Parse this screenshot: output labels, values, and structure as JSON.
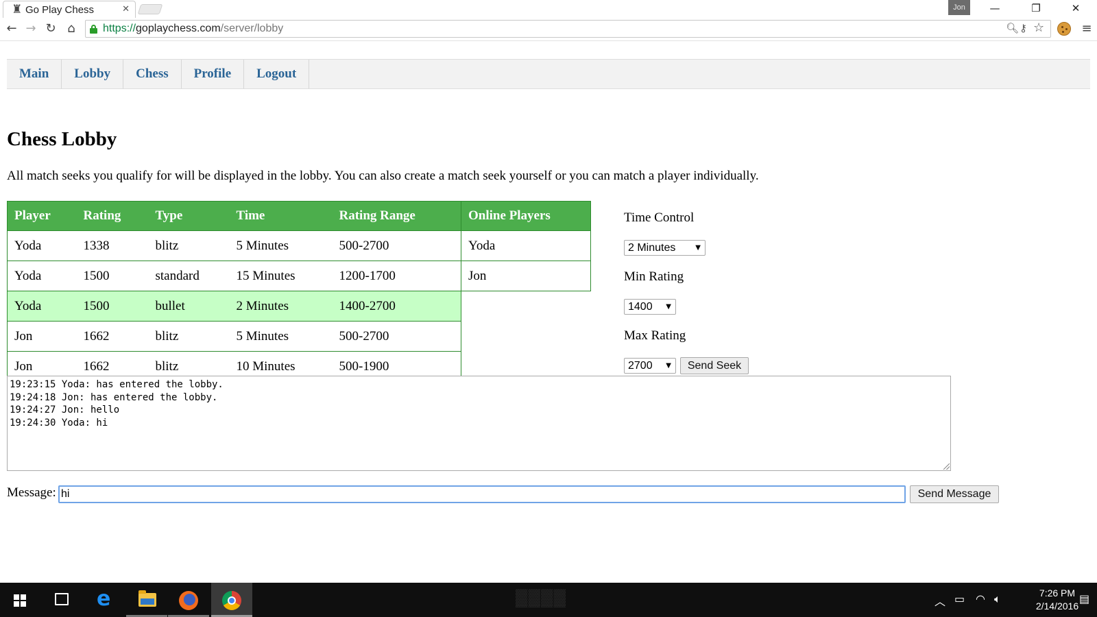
{
  "browser": {
    "tab_title": "Go Play Chess",
    "tab_icon": "rook-icon",
    "profile_name": "Jon",
    "url_scheme": "https://",
    "url_host": "goplaychess.com",
    "url_path": "/server/lobby"
  },
  "nav": {
    "items": [
      "Main",
      "Lobby",
      "Chess",
      "Profile",
      "Logout"
    ]
  },
  "page": {
    "title": "Chess Lobby",
    "intro": "All match seeks you qualify for will be displayed in the lobby. You can also create a match seek yourself or you can match a player individually."
  },
  "seeks": {
    "headers": [
      "Player",
      "Rating",
      "Type",
      "Time",
      "Rating Range"
    ],
    "rows": [
      [
        "Yoda",
        "1338",
        "blitz",
        "5 Minutes",
        "500-2700"
      ],
      [
        "Yoda",
        "1500",
        "standard",
        "15 Minutes",
        "1200-1700"
      ],
      [
        "Yoda",
        "1500",
        "bullet",
        "2 Minutes",
        "1400-2700"
      ],
      [
        "Jon",
        "1662",
        "blitz",
        "5 Minutes",
        "500-2700"
      ],
      [
        "Jon",
        "1662",
        "blitz",
        "10 Minutes",
        "500-1900"
      ]
    ],
    "highlight_color": "#c6ffc6",
    "header_color": "#4cae4c"
  },
  "online": {
    "header": "Online Players",
    "players": [
      "Yoda",
      "Jon"
    ]
  },
  "seek_form": {
    "time_control_label": "Time Control",
    "time_control_value": "2 Minutes",
    "min_rating_label": "Min Rating",
    "min_rating_value": "1400",
    "max_rating_label": "Max Rating",
    "max_rating_value": "2700",
    "send_seek_label": "Send Seek"
  },
  "chat": {
    "lines": [
      "19:23:15 Yoda: has entered the lobby.",
      "19:24:18 Jon: has entered the lobby.",
      "19:24:27 Jon: hello",
      "19:24:30 Yoda: hi"
    ],
    "message_label": "Message:",
    "message_value": "hi",
    "send_label": "Send Message"
  },
  "taskbar": {
    "time": "7:26 PM",
    "date": "2/14/2016"
  }
}
